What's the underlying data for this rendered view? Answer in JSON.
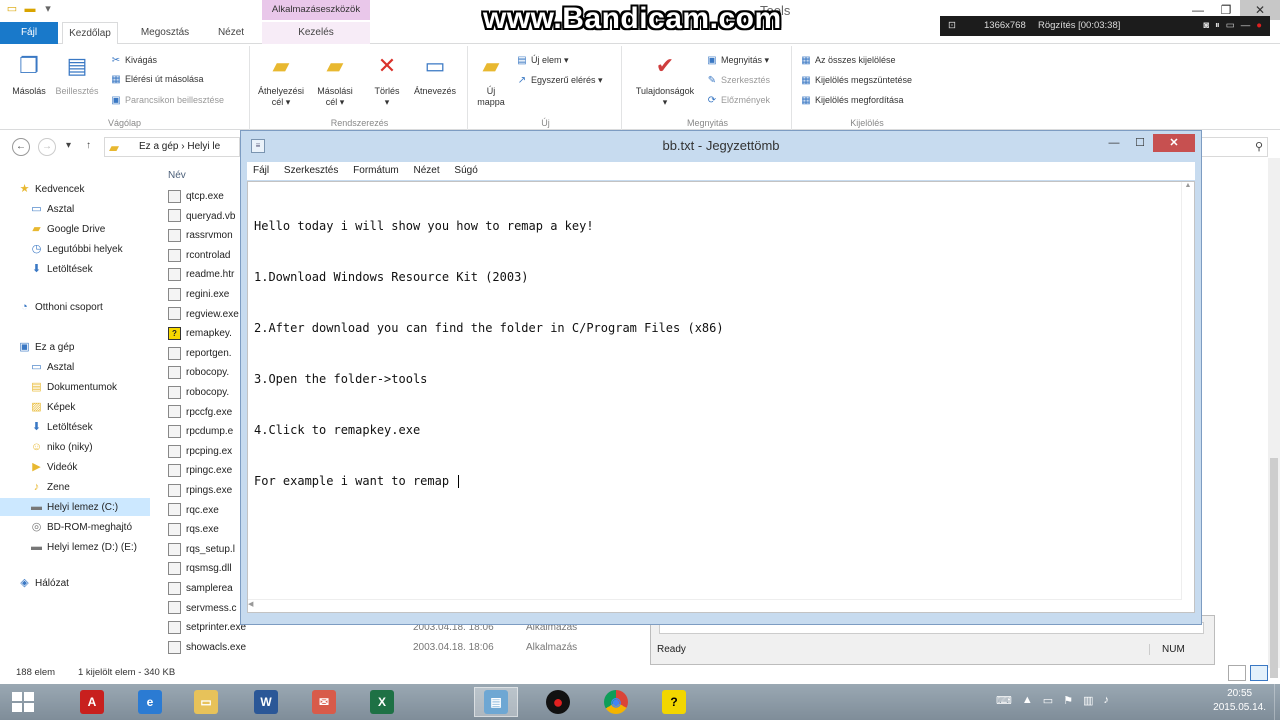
{
  "explorer": {
    "title": "Tools",
    "contextual_tab_group": "Alkalmazáseszközök",
    "tabs": [
      "Fájl",
      "Kezdőlap",
      "Megosztás",
      "Nézet",
      "Kezelés"
    ],
    "ribbon": {
      "clipboard": {
        "label": "Vágólap",
        "copy": "Másolás",
        "paste": "Beillesztés",
        "cut": "Kivágás",
        "copy_path": "Elérési út másolása",
        "paste_shortcut": "Parancsikon beillesztése"
      },
      "organize": {
        "label": "Rendszerezés",
        "move_to_1": "Áthelyezési",
        "move_to_2": "cél",
        "copy_to_1": "Másolási",
        "copy_to_2": "cél",
        "delete": "Törlés",
        "rename": "Átnevezés"
      },
      "new": {
        "label": "Új",
        "new_folder_1": "Új",
        "new_folder_2": "mappa",
        "new_item": "Új elem",
        "easy_access": "Egyszerű elérés"
      },
      "open": {
        "label": "Megnyitás",
        "properties": "Tulajdonságok",
        "open": "Megnyitás",
        "edit": "Szerkesztés",
        "history": "Előzmények"
      },
      "select": {
        "label": "Kijelölés",
        "select_all": "Az összes kijelölése",
        "select_none": "Kijelölés megszüntetése",
        "invert": "Kijelölés megfordítása"
      }
    },
    "breadcrumb": [
      "Ez a gép",
      "Helyi le"
    ],
    "nav": [
      {
        "label": "Kedvencek",
        "icon": "star-icon"
      },
      {
        "label": "Asztal",
        "icon": "desktop-icon"
      },
      {
        "label": "Google Drive",
        "icon": "folder-icon"
      },
      {
        "label": "Legutóbbi helyek",
        "icon": "recent-icon"
      },
      {
        "label": "Letöltések",
        "icon": "download-icon"
      },
      {
        "label": "Otthoni csoport",
        "icon": "homegroup-icon"
      },
      {
        "label": "Ez a gép",
        "icon": "computer-icon"
      },
      {
        "label": "Asztal",
        "icon": "desktop-icon"
      },
      {
        "label": "Dokumentumok",
        "icon": "documents-icon"
      },
      {
        "label": "Képek",
        "icon": "pictures-icon"
      },
      {
        "label": "Letöltések",
        "icon": "download-icon"
      },
      {
        "label": "niko (niky)",
        "icon": "user-icon"
      },
      {
        "label": "Videók",
        "icon": "videos-icon"
      },
      {
        "label": "Zene",
        "icon": "music-icon"
      },
      {
        "label": "Helyi lemez (C:)",
        "icon": "drive-icon"
      },
      {
        "label": "BD-ROM-meghajtó",
        "icon": "disc-icon"
      },
      {
        "label": "Helyi lemez (D:) (E:)",
        "icon": "drive-icon"
      },
      {
        "label": "Hálózat",
        "icon": "network-icon"
      }
    ],
    "column_name": "Név",
    "files": [
      {
        "name": "qtcp.exe"
      },
      {
        "name": "queryad.vb"
      },
      {
        "name": "rassrvmon"
      },
      {
        "name": "rcontrolad"
      },
      {
        "name": "readme.htr"
      },
      {
        "name": "regini.exe"
      },
      {
        "name": "regview.exe"
      },
      {
        "name": "remapkey."
      },
      {
        "name": "reportgen."
      },
      {
        "name": "robocopy."
      },
      {
        "name": "robocopy."
      },
      {
        "name": "rpccfg.exe"
      },
      {
        "name": "rpcdump.e"
      },
      {
        "name": "rpcping.ex"
      },
      {
        "name": "rpingc.exe"
      },
      {
        "name": "rpings.exe"
      },
      {
        "name": "rqc.exe"
      },
      {
        "name": "rqs.exe"
      },
      {
        "name": "rqs_setup.l"
      },
      {
        "name": "rqsmsg.dll"
      },
      {
        "name": "samplerea"
      },
      {
        "name": "servmess.c"
      },
      {
        "name": "setprinter.exe",
        "date": "2003.04.18. 18:06",
        "type": "Alkalmazás"
      },
      {
        "name": "showacls.exe",
        "date": "2003.04.18. 18:06",
        "type": "Alkalmazás"
      }
    ],
    "status": {
      "count": "188 elem",
      "selected": "1 kijelölt elem - 340 KB"
    },
    "background_status": {
      "ready": "Ready",
      "num": "NUM"
    }
  },
  "notepad": {
    "title": "bb.txt - Jegyzettömb",
    "menu": [
      "Fájl",
      "Szerkesztés",
      "Formátum",
      "Nézet",
      "Súgó"
    ],
    "lines": [
      "Hello today i will show you how to remap a key!",
      "1.Download Windows Resource Kit (2003)",
      "2.After download you can find the folder in C/Program Files (x86)",
      "3.Open the folder->tools",
      "4.Click to remapkey.exe",
      "For example i want to remap "
    ]
  },
  "bandicam": {
    "watermark": "www.Bandicam.com",
    "resolution": "1366x768",
    "recording": "Rögzítés [00:03:38]"
  },
  "taskbar": {
    "apps": [
      {
        "name": "acrobat",
        "glyph": "A",
        "color": "#c8201e"
      },
      {
        "name": "internet-explorer",
        "glyph": "e",
        "color": "#2b7bd3"
      },
      {
        "name": "file-explorer",
        "glyph": "▭",
        "color": "#e7c25a"
      },
      {
        "name": "word",
        "glyph": "W",
        "color": "#2b5797"
      },
      {
        "name": "mail",
        "glyph": "✉",
        "color": "#d85b4a"
      },
      {
        "name": "excel",
        "glyph": "X",
        "color": "#1e7145"
      },
      {
        "name": "notepad",
        "glyph": "▤",
        "color": "#6ea7d3"
      },
      {
        "name": "bandicam",
        "glyph": "●",
        "color": "#111111"
      },
      {
        "name": "chrome",
        "glyph": "◉",
        "color": "#db4437"
      },
      {
        "name": "remapkey",
        "glyph": "?",
        "color": "#f2d600"
      }
    ],
    "time": "20:55",
    "date": "2015.05.14."
  }
}
